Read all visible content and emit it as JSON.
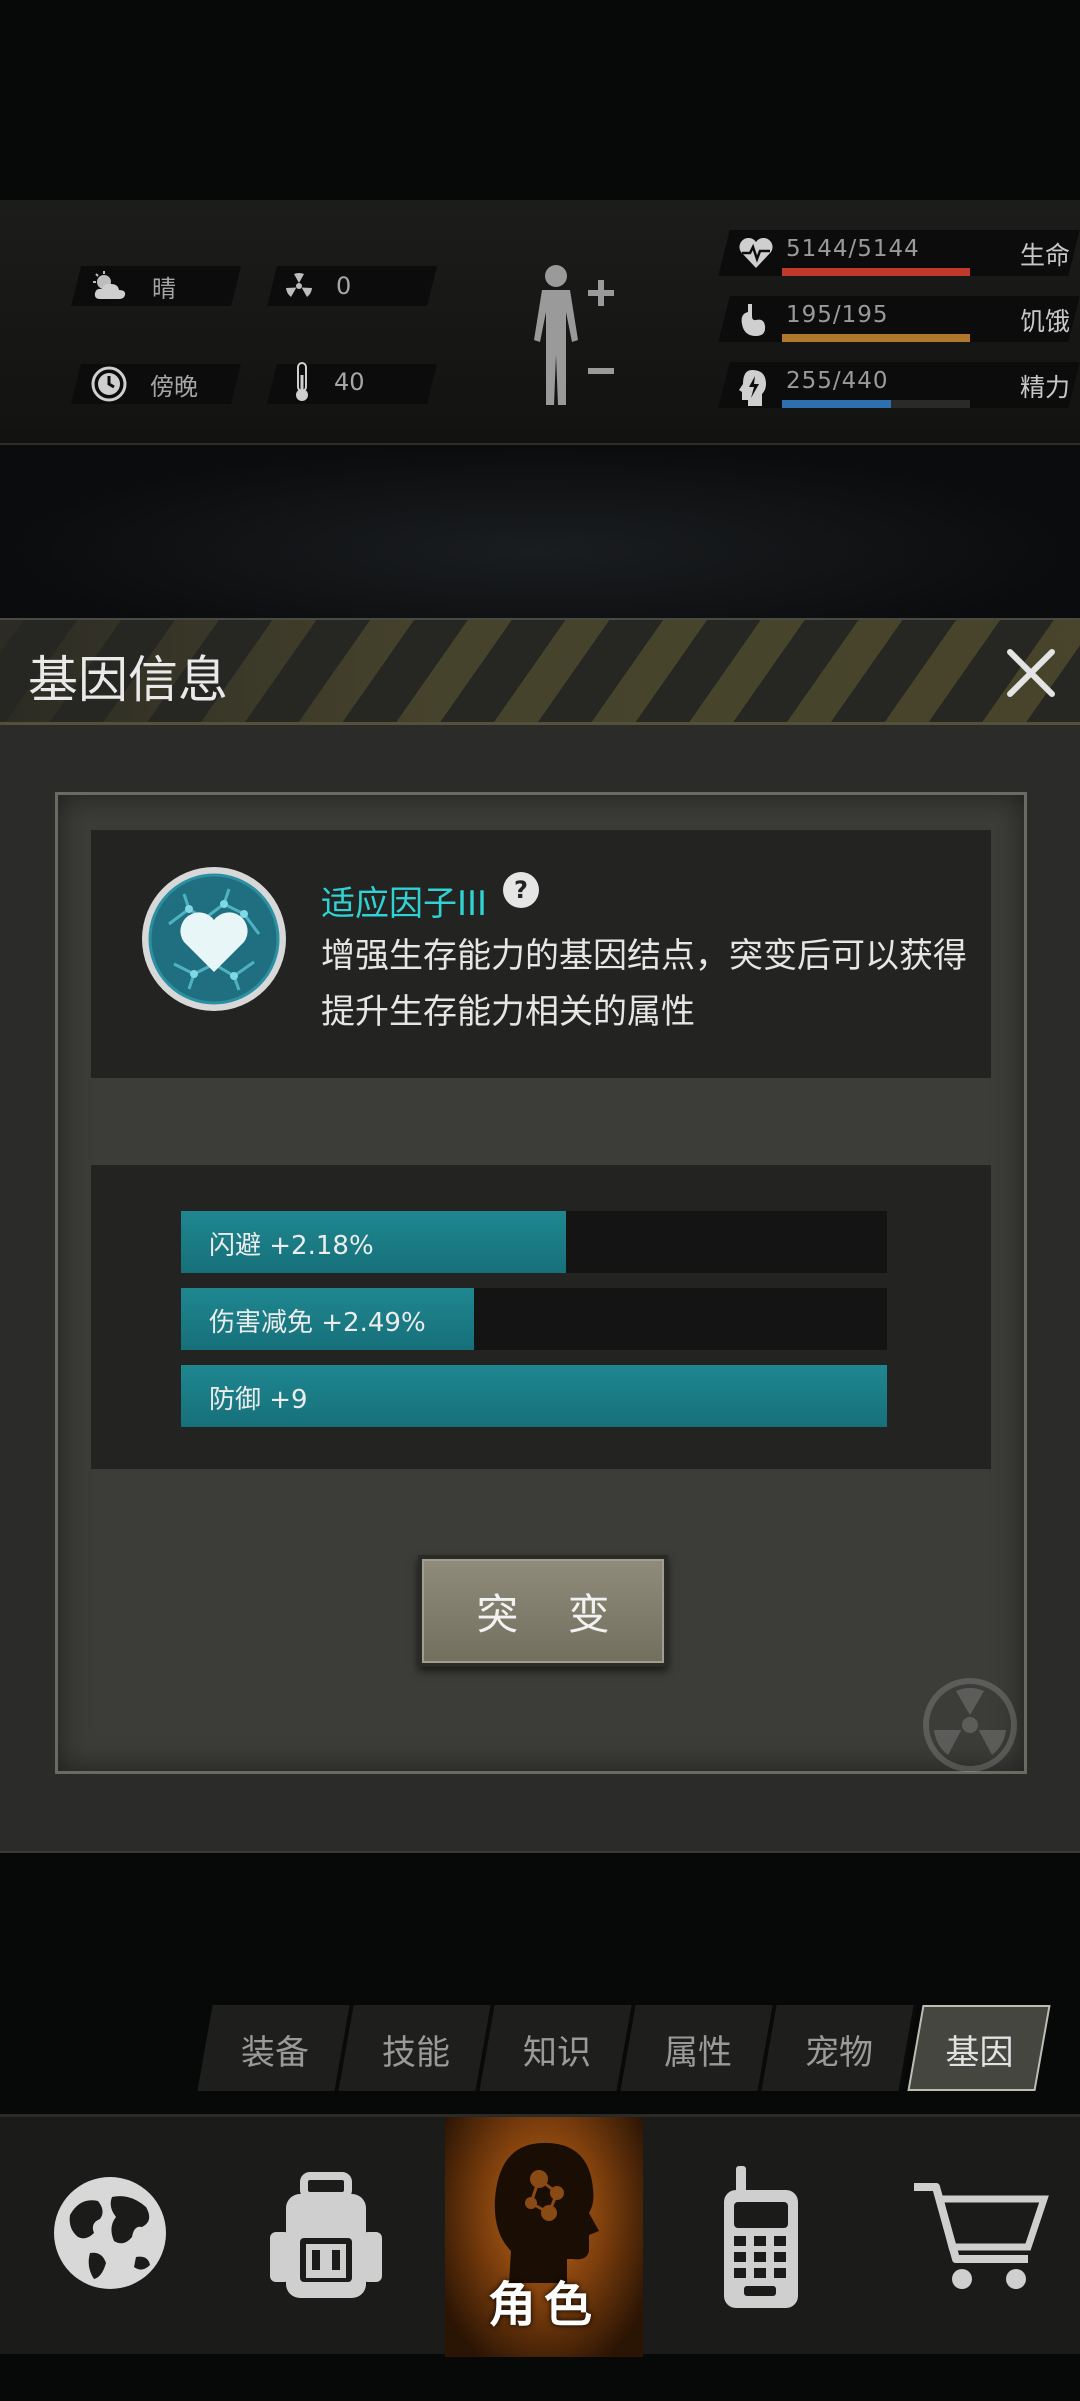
{
  "status": {
    "weather": "晴",
    "radiation": "0",
    "time_of_day": "傍晚",
    "temperature": "40",
    "health": {
      "value": "5144/5144",
      "label": "生命",
      "fraction": 1.0,
      "color": "#c0392b"
    },
    "hunger": {
      "value": "195/195",
      "label": "饥饿",
      "fraction": 1.0,
      "color": "#b0782a"
    },
    "energy": {
      "value": "255/440",
      "label": "精力",
      "fraction": 0.58,
      "color": "#2e6fb0"
    }
  },
  "dialog": {
    "title": "基因信息",
    "gene_name": "适应因子III",
    "gene_description": "增强生存能力的基因结点，突变后可以获得提升生存能力相关的属性",
    "attributes": [
      {
        "label": "闪避 +2.18%",
        "fraction": 0.545
      },
      {
        "label": "伤害减免 +2.49%",
        "fraction": 0.415
      },
      {
        "label": "防御 +9",
        "fraction": 1.0
      }
    ],
    "mutate_button": "突 变"
  },
  "sub_tabs": [
    "装备",
    "技能",
    "知识",
    "属性",
    "宠物",
    "基因"
  ],
  "active_sub_tab": "基因",
  "bottom_nav": {
    "items": [
      "world-map",
      "backpack",
      "character",
      "radio",
      "shop"
    ],
    "active_label": "角色"
  }
}
